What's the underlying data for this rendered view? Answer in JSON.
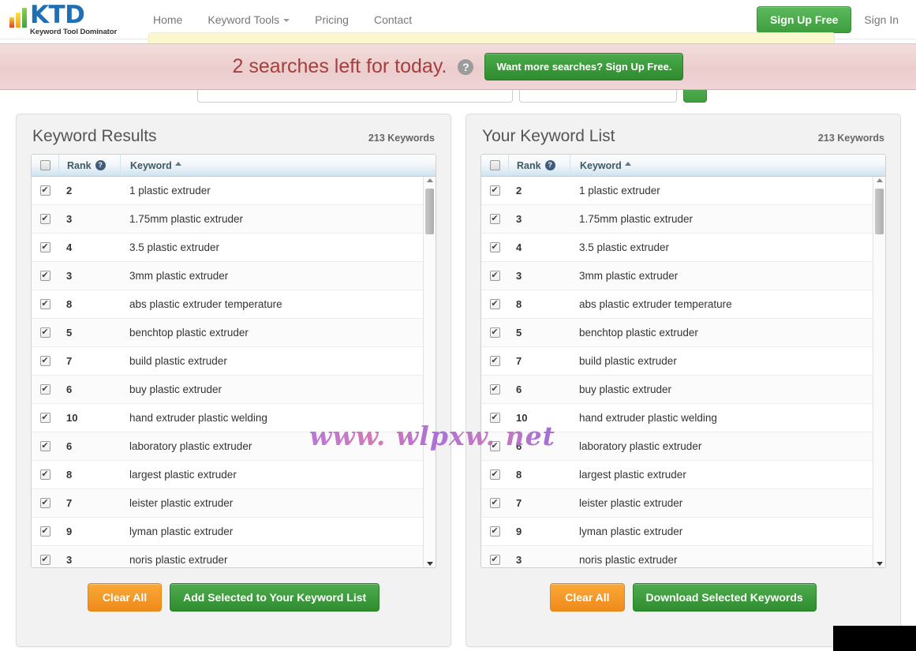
{
  "header": {
    "brand": {
      "initials": "KTD",
      "tagline": "Keyword Tool Dominator"
    },
    "nav": [
      {
        "label": "Home",
        "name": "nav-home",
        "caret": false
      },
      {
        "label": "Keyword Tools",
        "name": "nav-keyword-tools",
        "caret": true
      },
      {
        "label": "Pricing",
        "name": "nav-pricing",
        "caret": false
      },
      {
        "label": "Contact",
        "name": "nav-contact",
        "caret": false
      }
    ],
    "sign_up_label": "Sign Up Free",
    "sign_in_label": "Sign In"
  },
  "banner": {
    "message": "2 searches left for today.",
    "help_glyph": "?",
    "cta_label": "Want more searches? Sign Up Free.",
    "accent_text_color": "#a33f3f",
    "background_color": "#eccdcd",
    "cta_color": "#2e8b2e"
  },
  "search": {
    "keyword_value": "",
    "keyword_placeholder": "",
    "source_value": "",
    "submit_label": ""
  },
  "watermark": {
    "text": "www. wlpxw. net"
  },
  "table_columns": {
    "rank_label": "Rank",
    "keyword_label": "Keyword",
    "rank_help_glyph": "?",
    "sort_direction": "asc",
    "check_glyph": "✔"
  },
  "keywords": [
    {
      "rank": "2",
      "keyword": "1 plastic extruder",
      "checked": true
    },
    {
      "rank": "3",
      "keyword": "1.75mm plastic extruder",
      "checked": true
    },
    {
      "rank": "4",
      "keyword": "3.5 plastic extruder",
      "checked": true
    },
    {
      "rank": "3",
      "keyword": "3mm plastic extruder",
      "checked": true
    },
    {
      "rank": "8",
      "keyword": "abs plastic extruder temperature",
      "checked": true
    },
    {
      "rank": "5",
      "keyword": "benchtop plastic extruder",
      "checked": true
    },
    {
      "rank": "7",
      "keyword": "build plastic extruder",
      "checked": true
    },
    {
      "rank": "6",
      "keyword": "buy plastic extruder",
      "checked": true
    },
    {
      "rank": "10",
      "keyword": "hand extruder plastic welding",
      "checked": true
    },
    {
      "rank": "6",
      "keyword": "laboratory plastic extruder",
      "checked": true
    },
    {
      "rank": "8",
      "keyword": "largest plastic extruder",
      "checked": true
    },
    {
      "rank": "7",
      "keyword": "leister plastic extruder",
      "checked": true
    },
    {
      "rank": "9",
      "keyword": "lyman plastic extruder",
      "checked": true
    },
    {
      "rank": "3",
      "keyword": "noris plastic extruder",
      "checked": true
    }
  ],
  "left_panel": {
    "title": "Keyword Results",
    "count": "213 Keywords",
    "clear_label": "Clear All",
    "primary_label": "Add Selected to Your Keyword List"
  },
  "right_panel": {
    "title": "Your Keyword List",
    "count": "213 Keywords",
    "clear_label": "Clear All",
    "primary_label": "Download Selected Keywords"
  }
}
